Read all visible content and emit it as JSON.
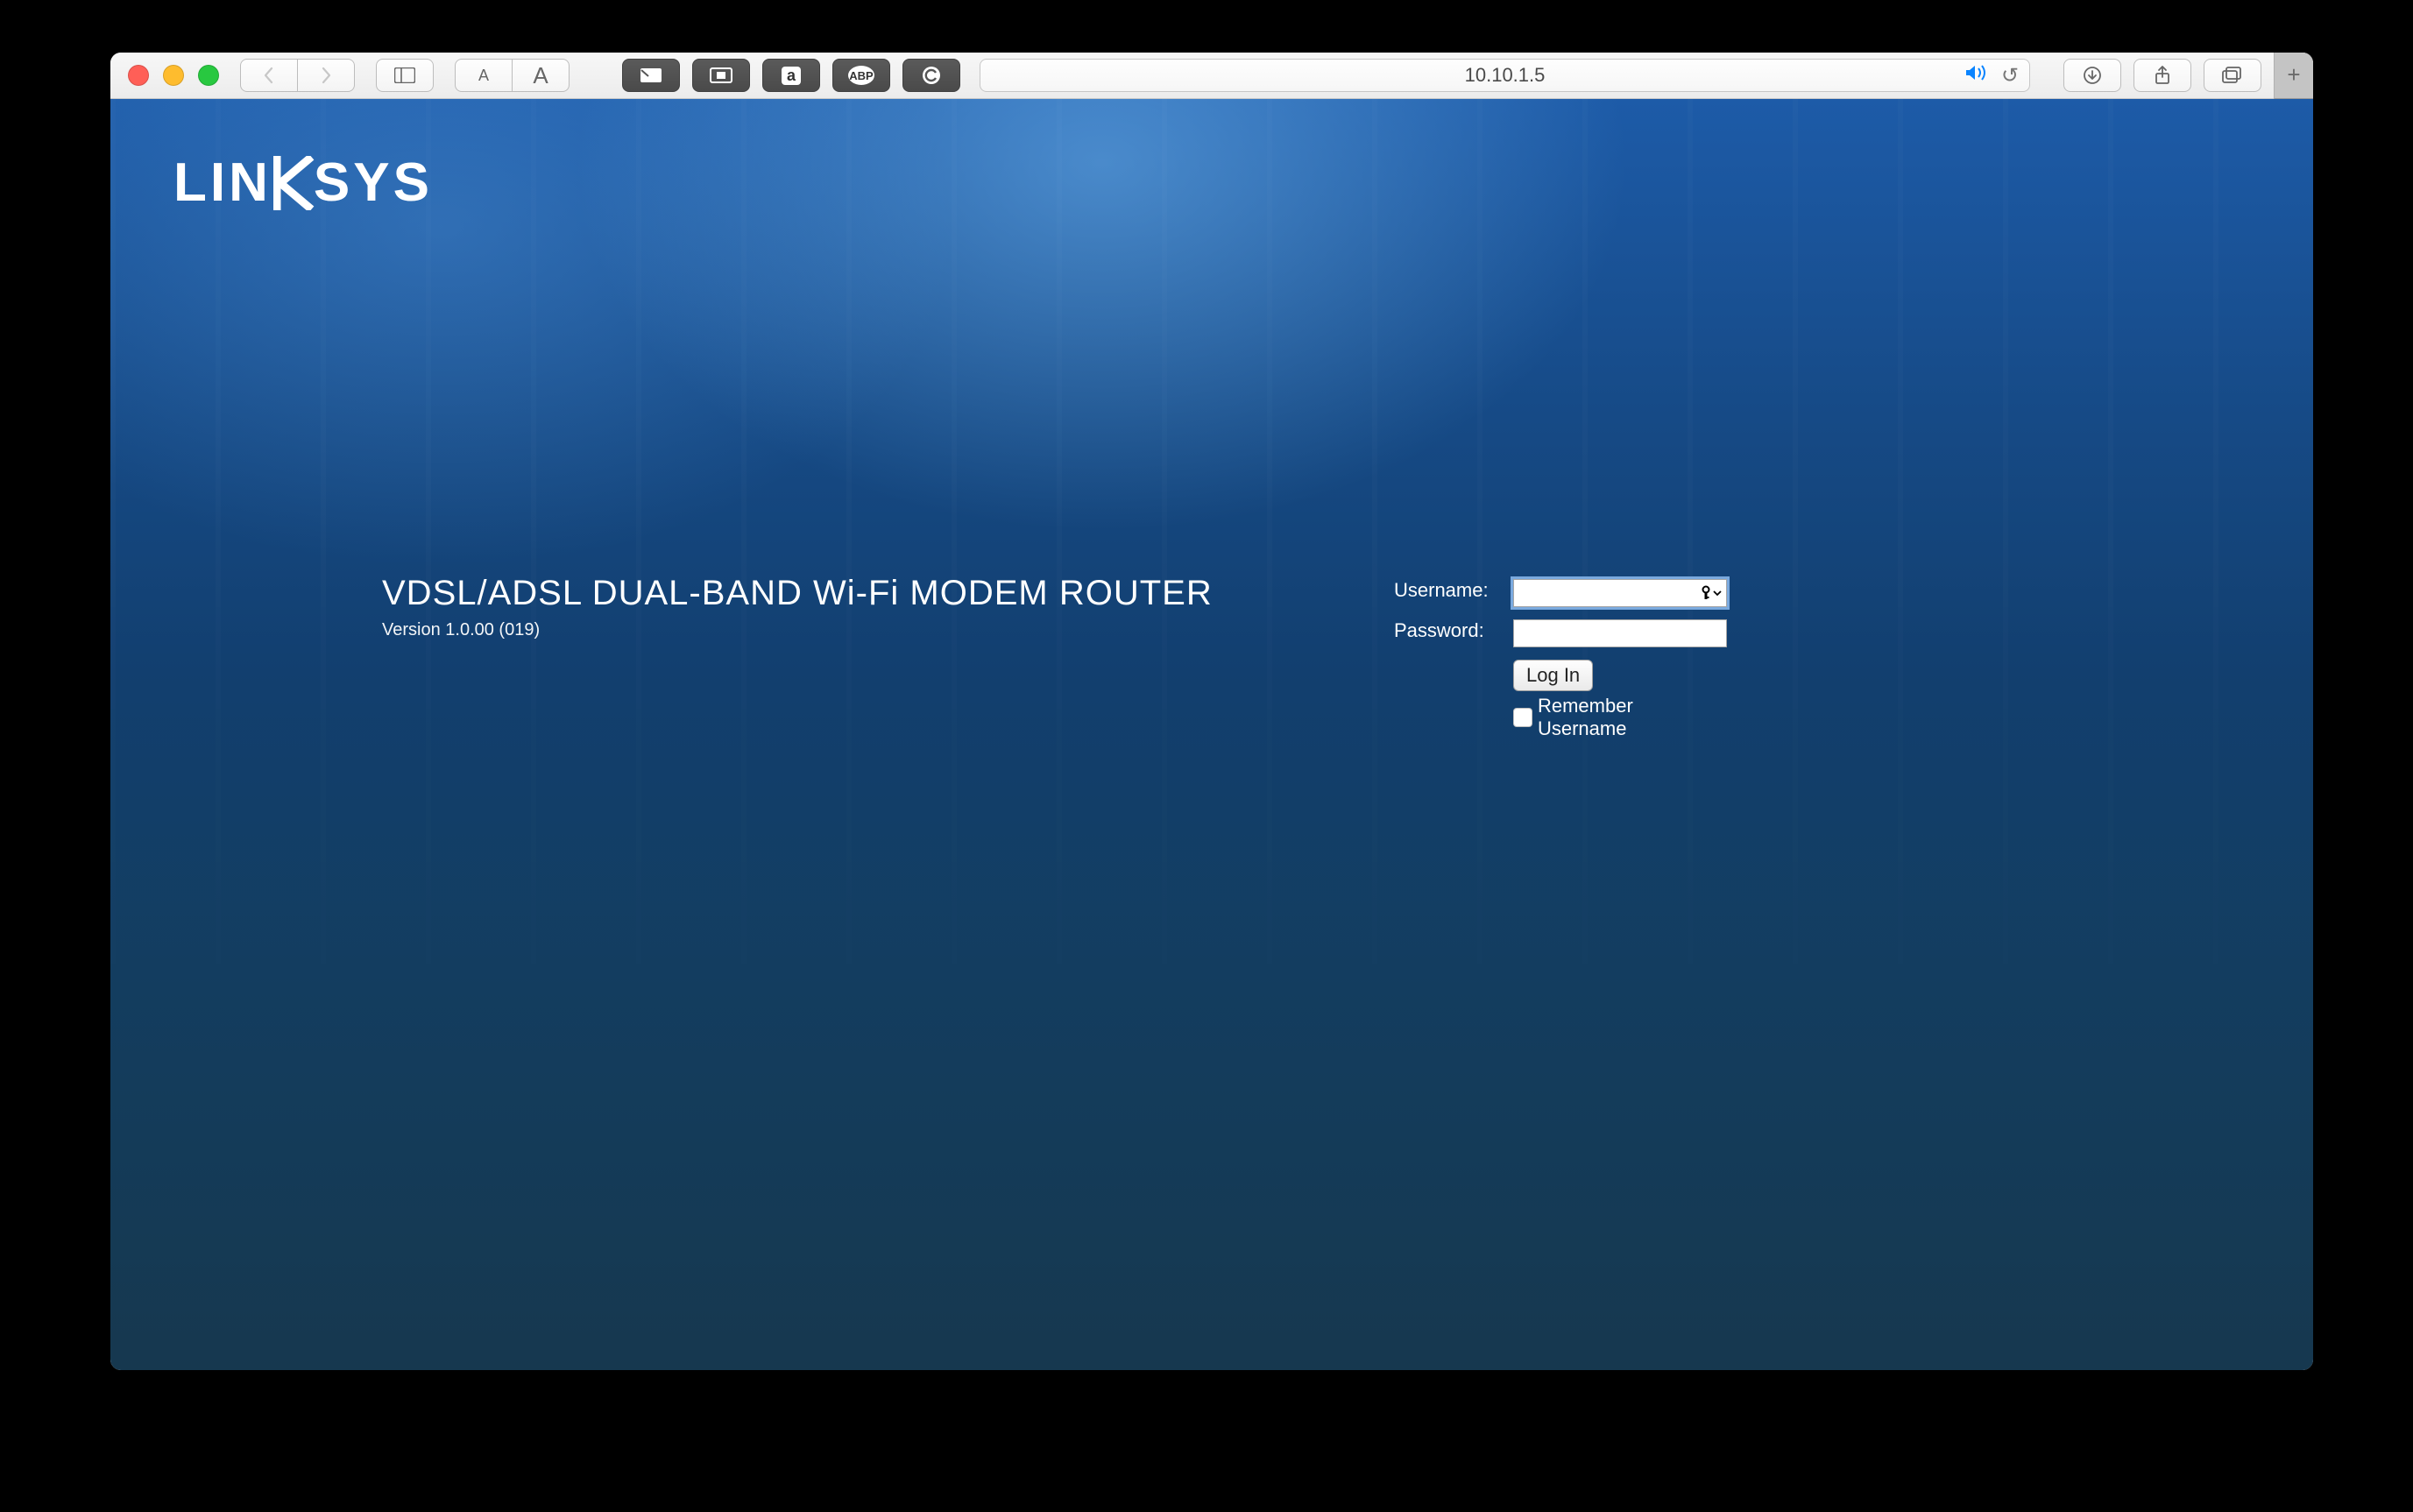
{
  "toolbar": {
    "url": "10.10.1.5",
    "buttons": {
      "text_small": "A",
      "text_large": "A",
      "ext_a_label": "a",
      "ext_abp_label": "ABP"
    }
  },
  "brand": "LINKSYS",
  "product": {
    "title": "VDSL/ADSL DUAL-BAND Wi-Fi MODEM ROUTER",
    "version": "Version 1.0.00 (019)"
  },
  "login": {
    "username_label": "Username:",
    "password_label": "Password:",
    "username_value": "",
    "password_value": "",
    "submit_label": "Log In",
    "remember_label": "Remember Username",
    "remember_checked": false
  }
}
